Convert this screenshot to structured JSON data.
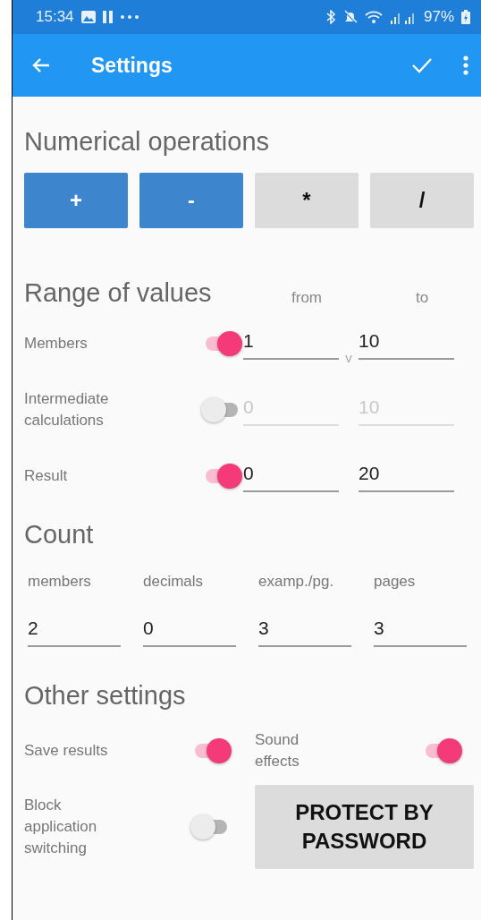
{
  "status_bar": {
    "time": "15:34",
    "battery": "97%"
  },
  "app_bar": {
    "title": "Settings"
  },
  "operations": {
    "title": "Numerical operations",
    "buttons": [
      {
        "label": "+",
        "selected": true
      },
      {
        "label": "-",
        "selected": true
      },
      {
        "label": "*",
        "selected": false
      },
      {
        "label": "/",
        "selected": false
      }
    ]
  },
  "range": {
    "title": "Range of values",
    "from_label": "from",
    "to_label": "to",
    "rows": [
      {
        "label": "Members",
        "on": true,
        "from": "1",
        "to": "10",
        "separator": "v"
      },
      {
        "label": "Intermediate calculations",
        "on": false,
        "from": "0",
        "to": "10"
      },
      {
        "label": "Result",
        "on": true,
        "from": "0",
        "to": "20"
      }
    ]
  },
  "count": {
    "title": "Count",
    "columns": [
      {
        "label": "members",
        "value": "2"
      },
      {
        "label": "decimals",
        "value": "0"
      },
      {
        "label": "examp./pg.",
        "value": "3"
      },
      {
        "label": "pages",
        "value": "3"
      }
    ]
  },
  "other": {
    "title": "Other settings",
    "items": [
      {
        "kind": "toggle",
        "label": "Save results",
        "on": true
      },
      {
        "kind": "toggle",
        "label": "Sound effects",
        "on": true
      },
      {
        "kind": "toggle",
        "label": "Block application switching",
        "on": false
      },
      {
        "kind": "button",
        "label": "PROTECT BY PASSWORD"
      }
    ]
  }
}
